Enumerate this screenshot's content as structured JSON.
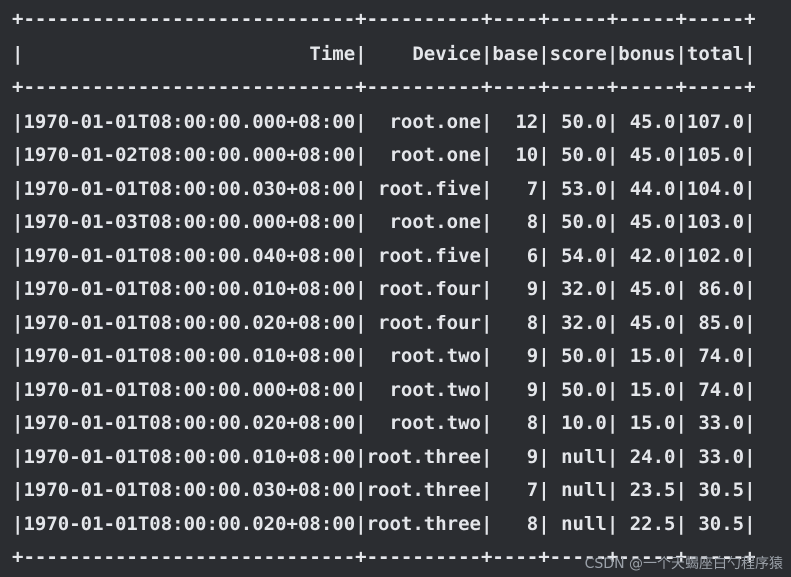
{
  "terminal": {
    "border": "+-----------------------------+----------+----+-----+-----+-----+",
    "header": "|                         Time|    Device|base|score|bonus|total|",
    "rows": [
      "|1970-01-01T08:00:00.000+08:00|  root.one|  12| 50.0| 45.0|107.0|",
      "|1970-01-02T08:00:00.000+08:00|  root.one|  10| 50.0| 45.0|105.0|",
      "|1970-01-01T08:00:00.030+08:00| root.five|   7| 53.0| 44.0|104.0|",
      "|1970-01-03T08:00:00.000+08:00|  root.one|   8| 50.0| 45.0|103.0|",
      "|1970-01-01T08:00:00.040+08:00| root.five|   6| 54.0| 42.0|102.0|",
      "|1970-01-01T08:00:00.010+08:00| root.four|   9| 32.0| 45.0| 86.0|",
      "|1970-01-01T08:00:00.020+08:00| root.four|   8| 32.0| 45.0| 85.0|",
      "|1970-01-01T08:00:00.010+08:00|  root.two|   9| 50.0| 15.0| 74.0|",
      "|1970-01-01T08:00:00.000+08:00|  root.two|   9| 50.0| 15.0| 74.0|",
      "|1970-01-01T08:00:00.020+08:00|  root.two|   8| 10.0| 15.0| 33.0|",
      "|1970-01-01T08:00:00.010+08:00|root.three|   9| null| 24.0| 33.0|",
      "|1970-01-01T08:00:00.030+08:00|root.three|   7| null| 23.5| 30.5|",
      "|1970-01-01T08:00:00.020+08:00|root.three|   8| null| 22.5| 30.5|"
    ],
    "watermark": "CSDN @一个天蝎座白勺程序猿"
  },
  "colors": {
    "background": "#2b2d31",
    "text": "#e4e6ea"
  }
}
